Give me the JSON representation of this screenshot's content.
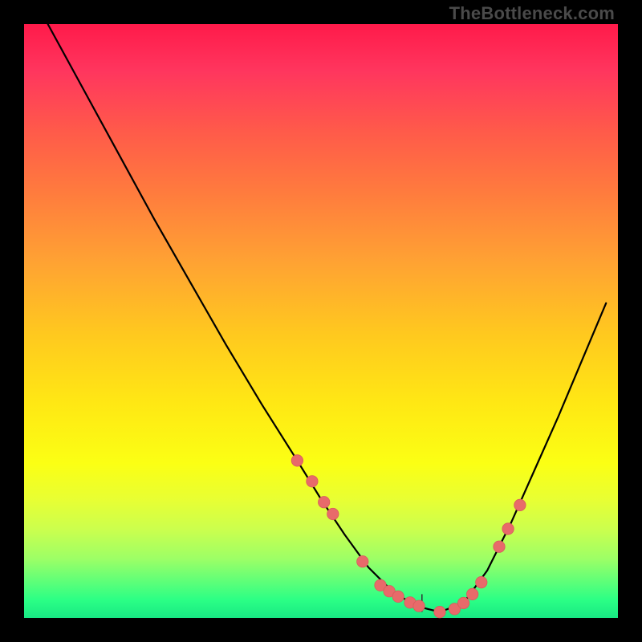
{
  "watermark": "TheBottleneck.com",
  "colors": {
    "dot_fill": "#e86a6a",
    "dot_stroke": "#d85c5c",
    "curve": "#000000"
  },
  "chart_data": {
    "type": "line",
    "title": "",
    "xlabel": "",
    "ylabel": "",
    "xlim": [
      0,
      100
    ],
    "ylim": [
      0,
      100
    ],
    "grid": false,
    "series": [
      {
        "name": "curve",
        "x": [
          4,
          10,
          16,
          22,
          28,
          34,
          40,
          46,
          50,
          54,
          58,
          62,
          66,
          70,
          74,
          78,
          82,
          86,
          90,
          94,
          98
        ],
        "y": [
          100,
          89,
          78,
          67,
          56.5,
          46,
          36,
          26.5,
          20,
          14,
          8.5,
          4.5,
          2,
          1,
          2.5,
          8,
          16,
          25,
          34,
          43.5,
          53
        ]
      }
    ],
    "scatter": {
      "name": "dots",
      "x": [
        46,
        48.5,
        50.5,
        52,
        57,
        60,
        61.5,
        63,
        65,
        66.5,
        70,
        72.5,
        74,
        75.5,
        77,
        80,
        81.5,
        83.5
      ],
      "y": [
        26.5,
        23,
        19.5,
        17.5,
        9.5,
        5.5,
        4.5,
        3.6,
        2.6,
        2,
        1,
        1.5,
        2.5,
        4,
        6,
        12,
        15,
        19
      ]
    },
    "center_tick": {
      "x": 67,
      "y_from": 1,
      "y_to": 4
    }
  }
}
